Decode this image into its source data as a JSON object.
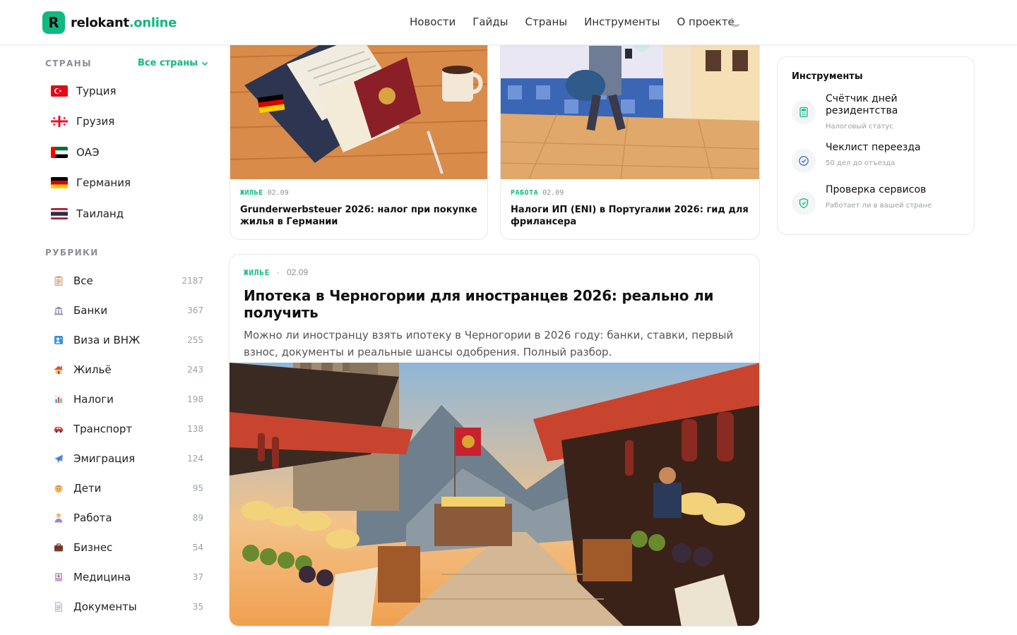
{
  "header": {
    "logo_letter": "R",
    "logo_name": "relokant",
    "logo_tld": ".online",
    "nav": [
      "Новости",
      "Гайды",
      "Страны",
      "Инструменты",
      "О проекте"
    ],
    "theme_icon": "moon-icon"
  },
  "sidebar": {
    "countries_title": "СТРАНЫ",
    "all_countries": "Все страны",
    "countries": [
      {
        "name": "Турция",
        "flag": "turkey"
      },
      {
        "name": "Грузия",
        "flag": "georgia"
      },
      {
        "name": "ОАЭ",
        "flag": "uae"
      },
      {
        "name": "Германия",
        "flag": "germany"
      },
      {
        "name": "Таиланд",
        "flag": "thailand"
      }
    ],
    "rubrics_title": "РУБРИКИ",
    "rubrics": [
      {
        "label": "Все",
        "count": "2187",
        "icon": "clipboard-icon"
      },
      {
        "label": "Банки",
        "count": "367",
        "icon": "bank-icon"
      },
      {
        "label": "Виза и ВНЖ",
        "count": "255",
        "icon": "passport-icon"
      },
      {
        "label": "Жильё",
        "count": "243",
        "icon": "house-icon"
      },
      {
        "label": "Налоги",
        "count": "198",
        "icon": "chart-icon"
      },
      {
        "label": "Транспорт",
        "count": "138",
        "icon": "car-icon"
      },
      {
        "label": "Эмиграция",
        "count": "124",
        "icon": "plane-icon"
      },
      {
        "label": "Дети",
        "count": "95",
        "icon": "child-icon"
      },
      {
        "label": "Работа",
        "count": "89",
        "icon": "worker-icon"
      },
      {
        "label": "Бизнес",
        "count": "54",
        "icon": "briefcase-icon"
      },
      {
        "label": "Медицина",
        "count": "37",
        "icon": "medical-icon"
      },
      {
        "label": "Документы",
        "count": "35",
        "icon": "document-icon"
      }
    ]
  },
  "cards": [
    {
      "category": "ЖИЛЬЕ",
      "date": "02.09",
      "title": "Grunderwerbsteuer 2026: налог при покупке жилья в Германии"
    },
    {
      "category": "РАБОТА",
      "date": "02.09",
      "title": "Налоги ИП (ENI) в Португалии 2026: гид для фрилансера"
    }
  ],
  "featured": {
    "category": "ЖИЛЬЕ",
    "separator": "·",
    "date": "02.09",
    "title": "Ипотека в Черногории для иностранцев 2026: реально ли получить",
    "description": "Можно ли иностранцу взять ипотеку в Черногории в 2026 году: банки, ставки, первый взнос, документы и реальные шансы одобрения. Полный разбор."
  },
  "tools": {
    "title": "Инструменты",
    "items": [
      {
        "name": "Счётчик дней резидентства",
        "sub": "Налоговый статус",
        "icon": "calculator-icon"
      },
      {
        "name": "Чеклист переезда",
        "sub": "50 дел до отъезда",
        "icon": "check-circle-icon"
      },
      {
        "name": "Проверка сервисов",
        "sub": "Работает ли в вашей стране",
        "icon": "shield-check-icon"
      }
    ]
  },
  "colors": {
    "accent": "#10b981"
  }
}
